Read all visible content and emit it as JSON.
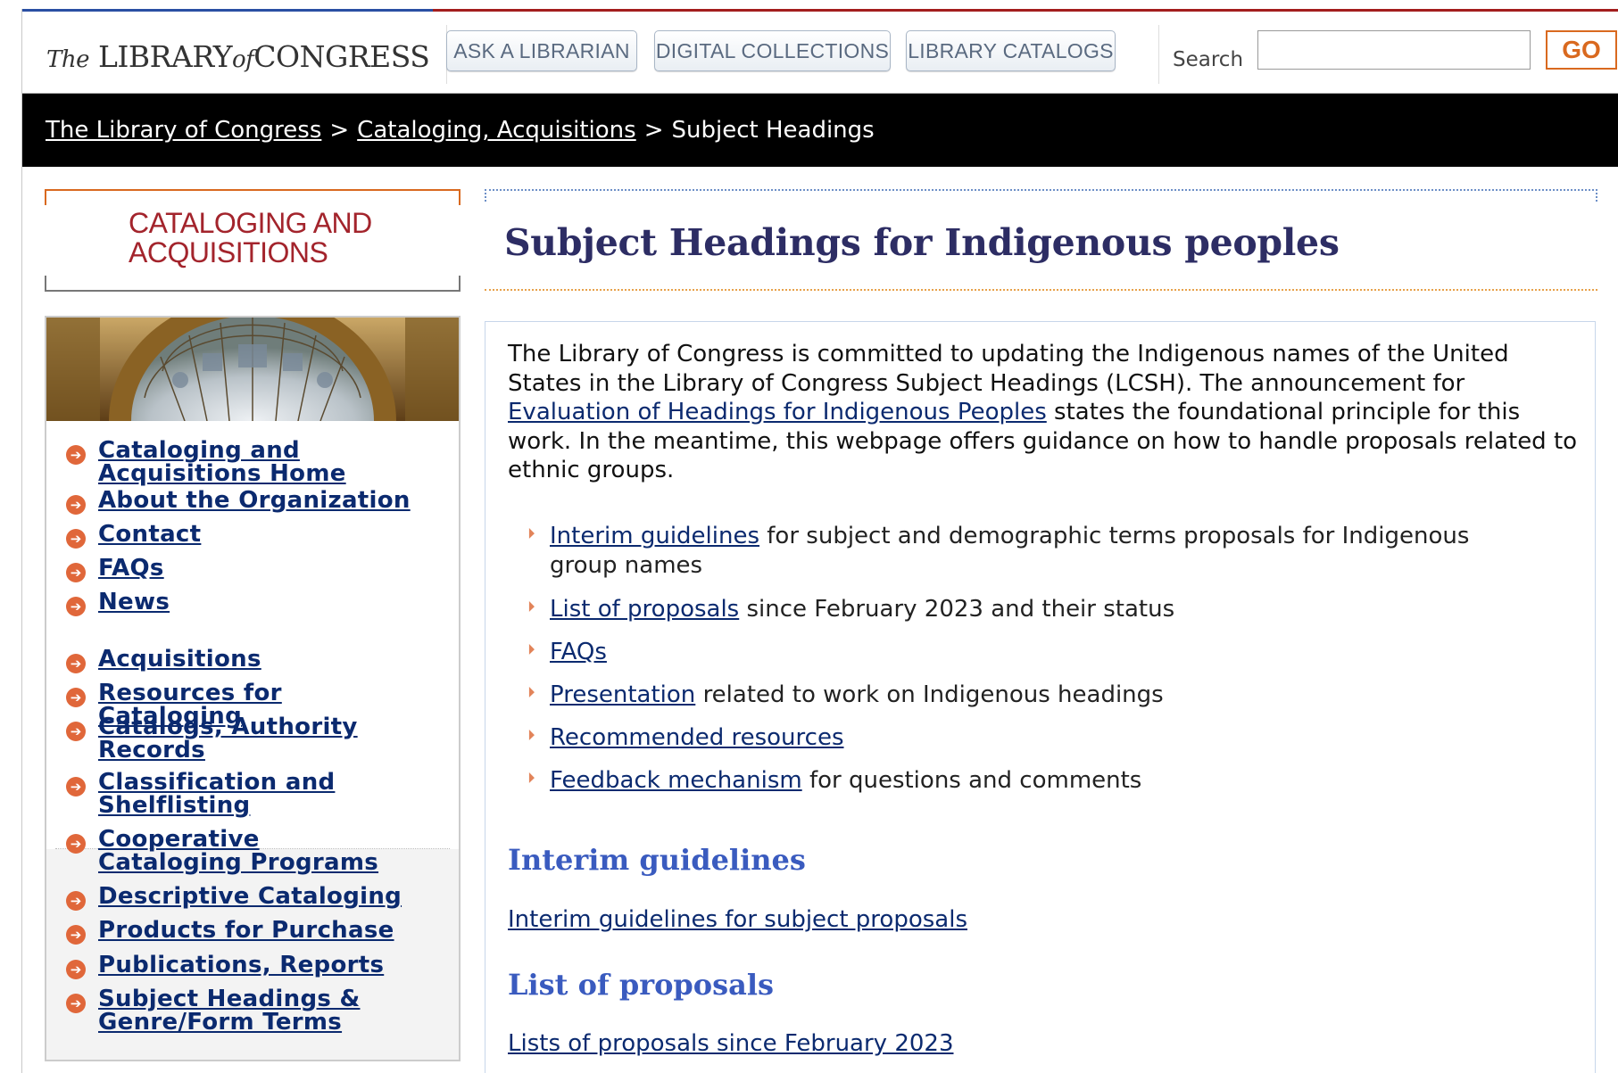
{
  "header": {
    "logo_pre": "The",
    "logo_main": "LIBRARY",
    "logo_of": "of",
    "logo_post": "CONGRESS",
    "buttons": [
      "ASK A LIBRARIAN",
      "DIGITAL COLLECTIONS",
      "LIBRARY CATALOGS"
    ],
    "search_label": "Search",
    "search_value": "",
    "go_label": "GO"
  },
  "breadcrumb": {
    "items": [
      "The Library of Congress",
      "Cataloging, Acquisitions",
      "Subject Headings"
    ],
    "separator": ">"
  },
  "sidebar": {
    "section_title": "CATALOGING AND ACQUISITIONS",
    "nav_primary": [
      "Cataloging and Acquisitions Home",
      "About the Organization",
      "Contact",
      "FAQs",
      "News"
    ],
    "nav_secondary": [
      "Acquisitions",
      "Resources for Cataloging",
      "Catalogs, Authority Records",
      "Classification and Shelflisting",
      "Cooperative Cataloging Programs",
      "Descriptive Cataloging",
      "Products for Purchase",
      "Publications, Reports",
      "Subject Headings & Genre/Form Terms"
    ]
  },
  "main": {
    "title": "Subject Headings for Indigenous peoples",
    "intro_before": "The Library of Congress is committed to updating the Indigenous names of the United States in the Library of Congress Subject Headings (LCSH). The announcement for",
    "intro_link": "Evaluation of Headings for Indigenous Peoples",
    "intro_after": "states the foundational principle for this work. In the meantime, this webpage offers guidance on how to handle proposals related to ethnic groups.",
    "list": [
      {
        "link": "Interim guidelines",
        "text": "for subject and demographic terms proposals for Indigenous group names"
      },
      {
        "link": "List of proposals",
        "text": "since February 2023 and their status"
      },
      {
        "link": "FAQs",
        "text": ""
      },
      {
        "link": "Presentation",
        "text": "related to work on Indigenous headings"
      },
      {
        "link": "Recommended resources",
        "text": ""
      },
      {
        "link": "Feedback mechanism",
        "text": "for questions and comments"
      }
    ],
    "section1_heading": "Interim guidelines",
    "section1_link": "Interim guidelines for subject proposals",
    "section2_heading": "List of proposals",
    "section2_link": "Lists of proposals since February 2023"
  },
  "colors": {
    "accent_orange": "#d9691f",
    "title_navy": "#2d2d64",
    "link": "#0b2a6f",
    "heading_blue": "#3a5bbf",
    "section_red": "#a3242c"
  }
}
